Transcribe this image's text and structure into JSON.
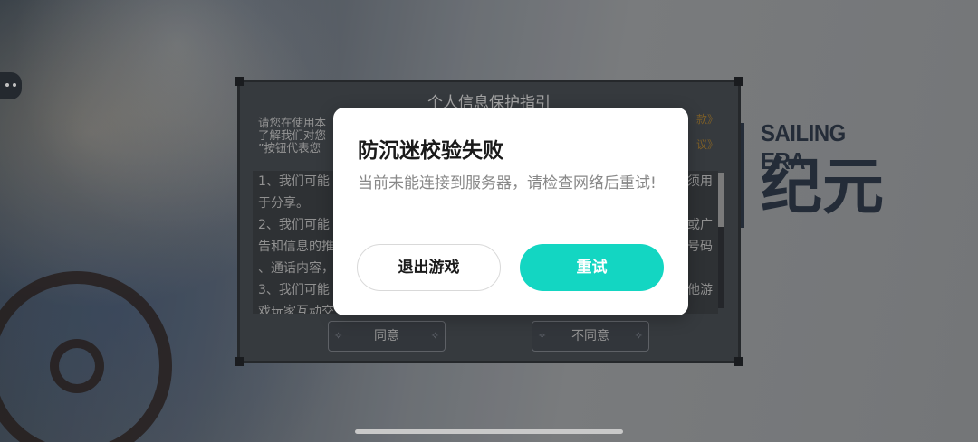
{
  "background": {
    "logo_latin": "SAILING ERA",
    "logo_cjk": "纪元"
  },
  "privacy_dialog": {
    "title": "个人信息保护指引",
    "intro_lines": [
      "请您在使用本",
      "了解我们对您",
      "”按钮代表您"
    ],
    "intro_links": [
      "款》",
      "议》"
    ],
    "body_lines": [
      "1、我们可能",
      "于分享。",
      "2、我们可能",
      "告和信息的推",
      "、通话内容，",
      "3、我们可能",
      "戏玩家互动交"
    ],
    "body_right_fragments": [
      "须用",
      "或广",
      "号码",
      "他游"
    ],
    "agree_label": "同意",
    "disagree_label": "不同意",
    "star_glyph": "✧"
  },
  "modal": {
    "title": "防沉迷校验失败",
    "message": "当前未能连接到服务器，请检查网络后重试!",
    "exit_label": "退出游戏",
    "retry_label": "重试"
  },
  "colors": {
    "retry_button": "#13d6c2",
    "modal_background": "#ffffff",
    "title_text": "#1a1a1a",
    "message_text": "#888888"
  }
}
